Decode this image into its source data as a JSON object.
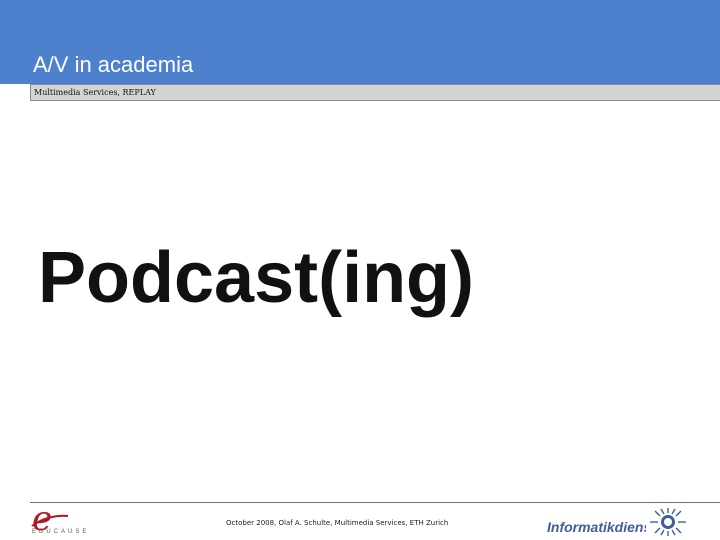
{
  "header": {
    "title": "A/V in academia",
    "subtitle": "Multimedia Services, REPLAY"
  },
  "slide": {
    "title": "Podcast(ing)"
  },
  "footer": {
    "text": "October 2008, Olaf A. Schulte, Multimedia Services, ETH Zurich",
    "left_logo_letter": "e",
    "left_logo_text": "EDUCAUSE",
    "right_logo_text": "Informatikdienste"
  },
  "colors": {
    "header_bg": "#4e81cd",
    "subtitle_bg": "#d4d4d4",
    "logo_red": "#b0182a",
    "logo_blue": "#3f5e99"
  },
  "icons": {
    "left_logo": "educause-logo-icon",
    "right_logo": "eth-sun-logo-icon"
  }
}
